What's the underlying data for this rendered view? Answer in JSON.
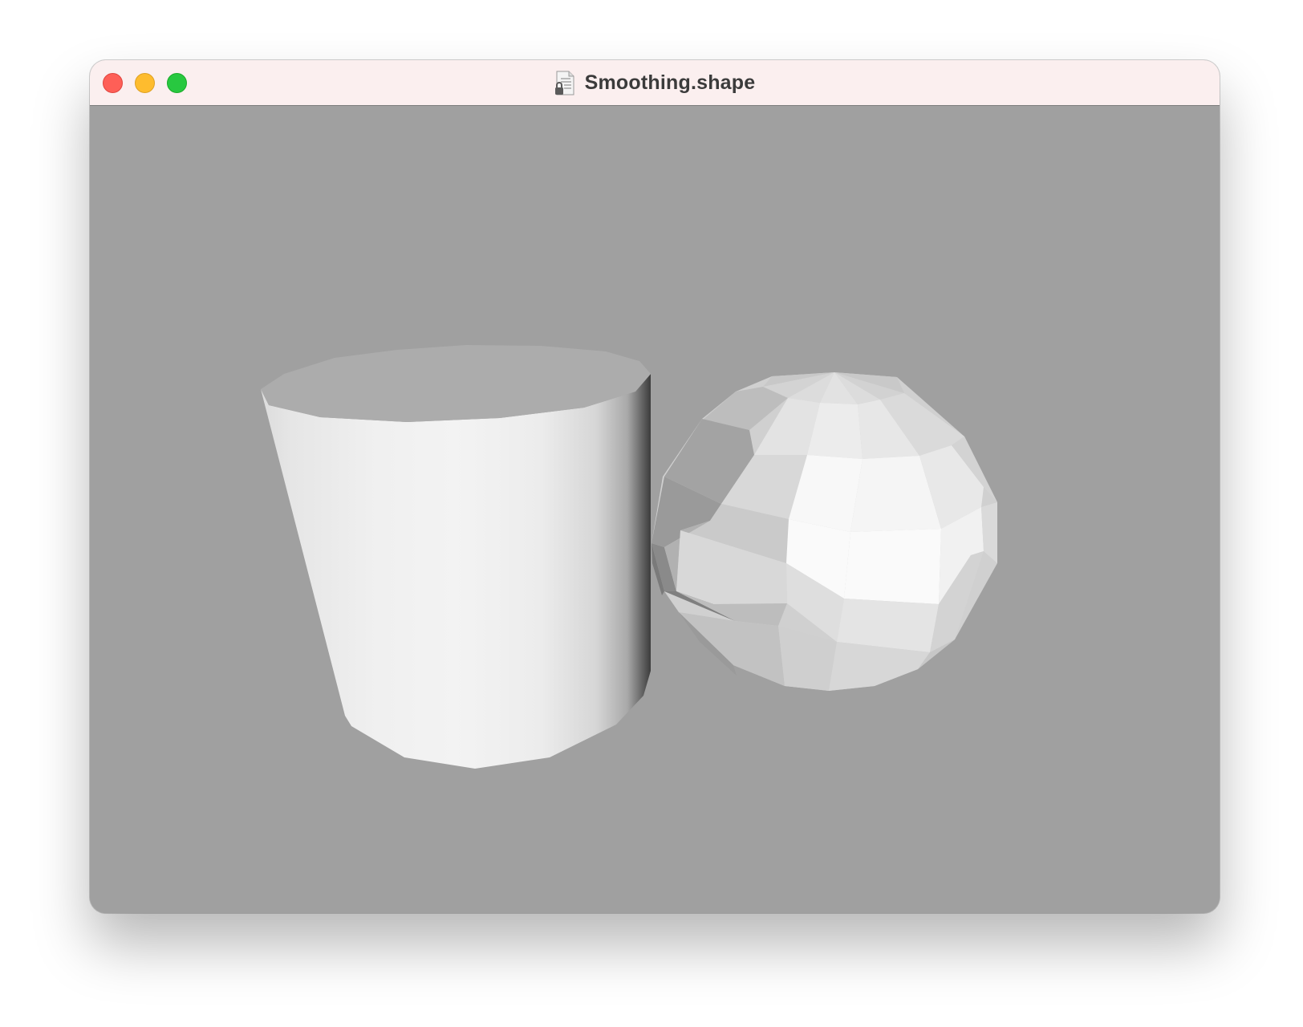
{
  "window": {
    "title": "Smoothing.shape",
    "document_icon": "locked-document-icon"
  },
  "traffic_lights": {
    "close": "close-icon",
    "minimize": "minimize-icon",
    "zoom": "zoom-icon"
  },
  "scene": {
    "background_color": "#a0a0a0",
    "objects": [
      {
        "name": "cylinder",
        "shading": "smooth"
      },
      {
        "name": "sphere",
        "shading": "flat"
      }
    ]
  }
}
